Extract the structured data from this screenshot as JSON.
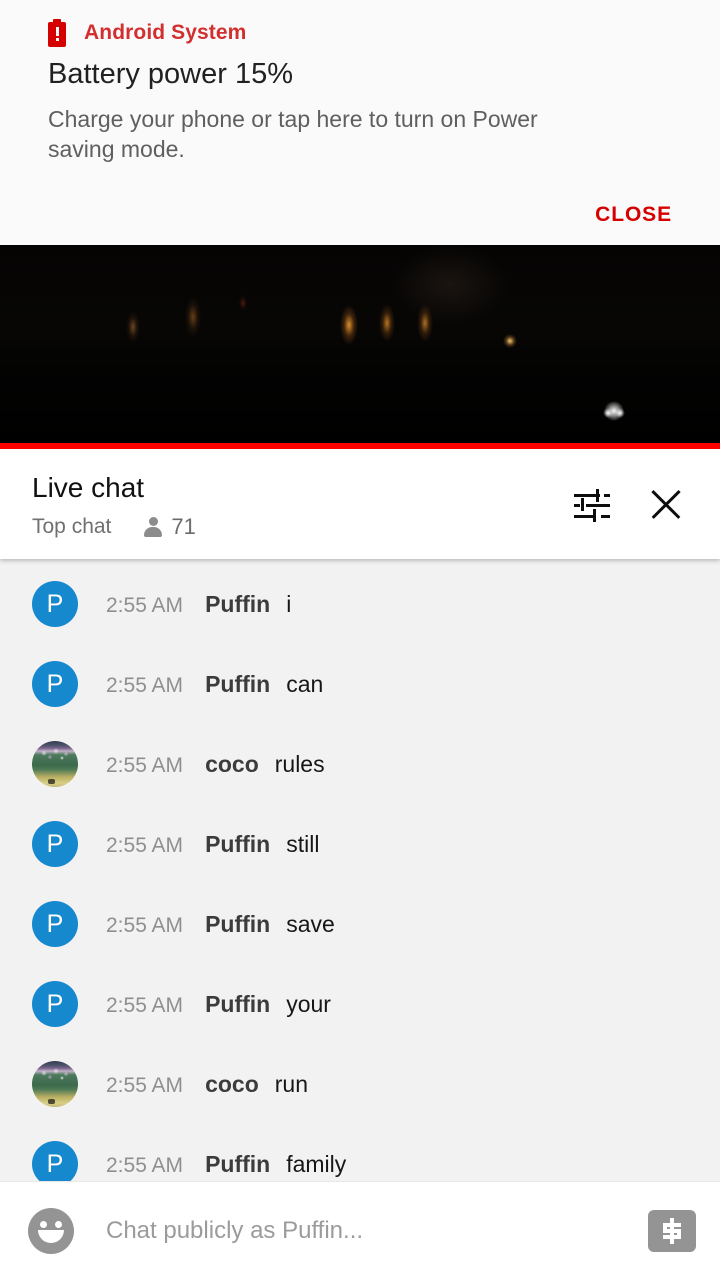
{
  "notification": {
    "app_icon": "battery-alert-icon",
    "app_name": "Android System",
    "title": "Battery power 15%",
    "body": "Charge your phone or tap here to turn on Power saving mode.",
    "close_label": "CLOSE",
    "accent_color": "#d50000",
    "background_color": "#fafafa"
  },
  "video": {
    "progress_color": "#ff0000",
    "background_color": "#000000"
  },
  "chat_header": {
    "title": "Live chat",
    "subtitle": "Top chat",
    "viewer_icon": "person-icon",
    "viewer_count": "71",
    "tune_icon": "tune-icon",
    "close_icon": "close-icon"
  },
  "chat": {
    "background_color": "#f2f2f2",
    "avatar_color": "#1588ce",
    "messages": [
      {
        "avatar_type": "letter",
        "avatar_letter": "P",
        "time": "2:55 AM",
        "author": "Puffin",
        "text": "i"
      },
      {
        "avatar_type": "letter",
        "avatar_letter": "P",
        "time": "2:55 AM",
        "author": "Puffin",
        "text": "can"
      },
      {
        "avatar_type": "photo",
        "avatar_letter": "",
        "time": "2:55 AM",
        "author": "coco",
        "text": "rules"
      },
      {
        "avatar_type": "letter",
        "avatar_letter": "P",
        "time": "2:55 AM",
        "author": "Puffin",
        "text": "still"
      },
      {
        "avatar_type": "letter",
        "avatar_letter": "P",
        "time": "2:55 AM",
        "author": "Puffin",
        "text": "save"
      },
      {
        "avatar_type": "letter",
        "avatar_letter": "P",
        "time": "2:55 AM",
        "author": "Puffin",
        "text": "your"
      },
      {
        "avatar_type": "photo",
        "avatar_letter": "",
        "time": "2:55 AM",
        "author": "coco",
        "text": "run"
      },
      {
        "avatar_type": "letter",
        "avatar_letter": "P",
        "time": "2:55 AM",
        "author": "Puffin",
        "text": "family"
      }
    ]
  },
  "input_bar": {
    "emoji_icon": "emoji-smiley-icon",
    "placeholder": "Chat publicly as Puffin...",
    "value": "",
    "superchat_icon": "dollar-sign-icon"
  }
}
